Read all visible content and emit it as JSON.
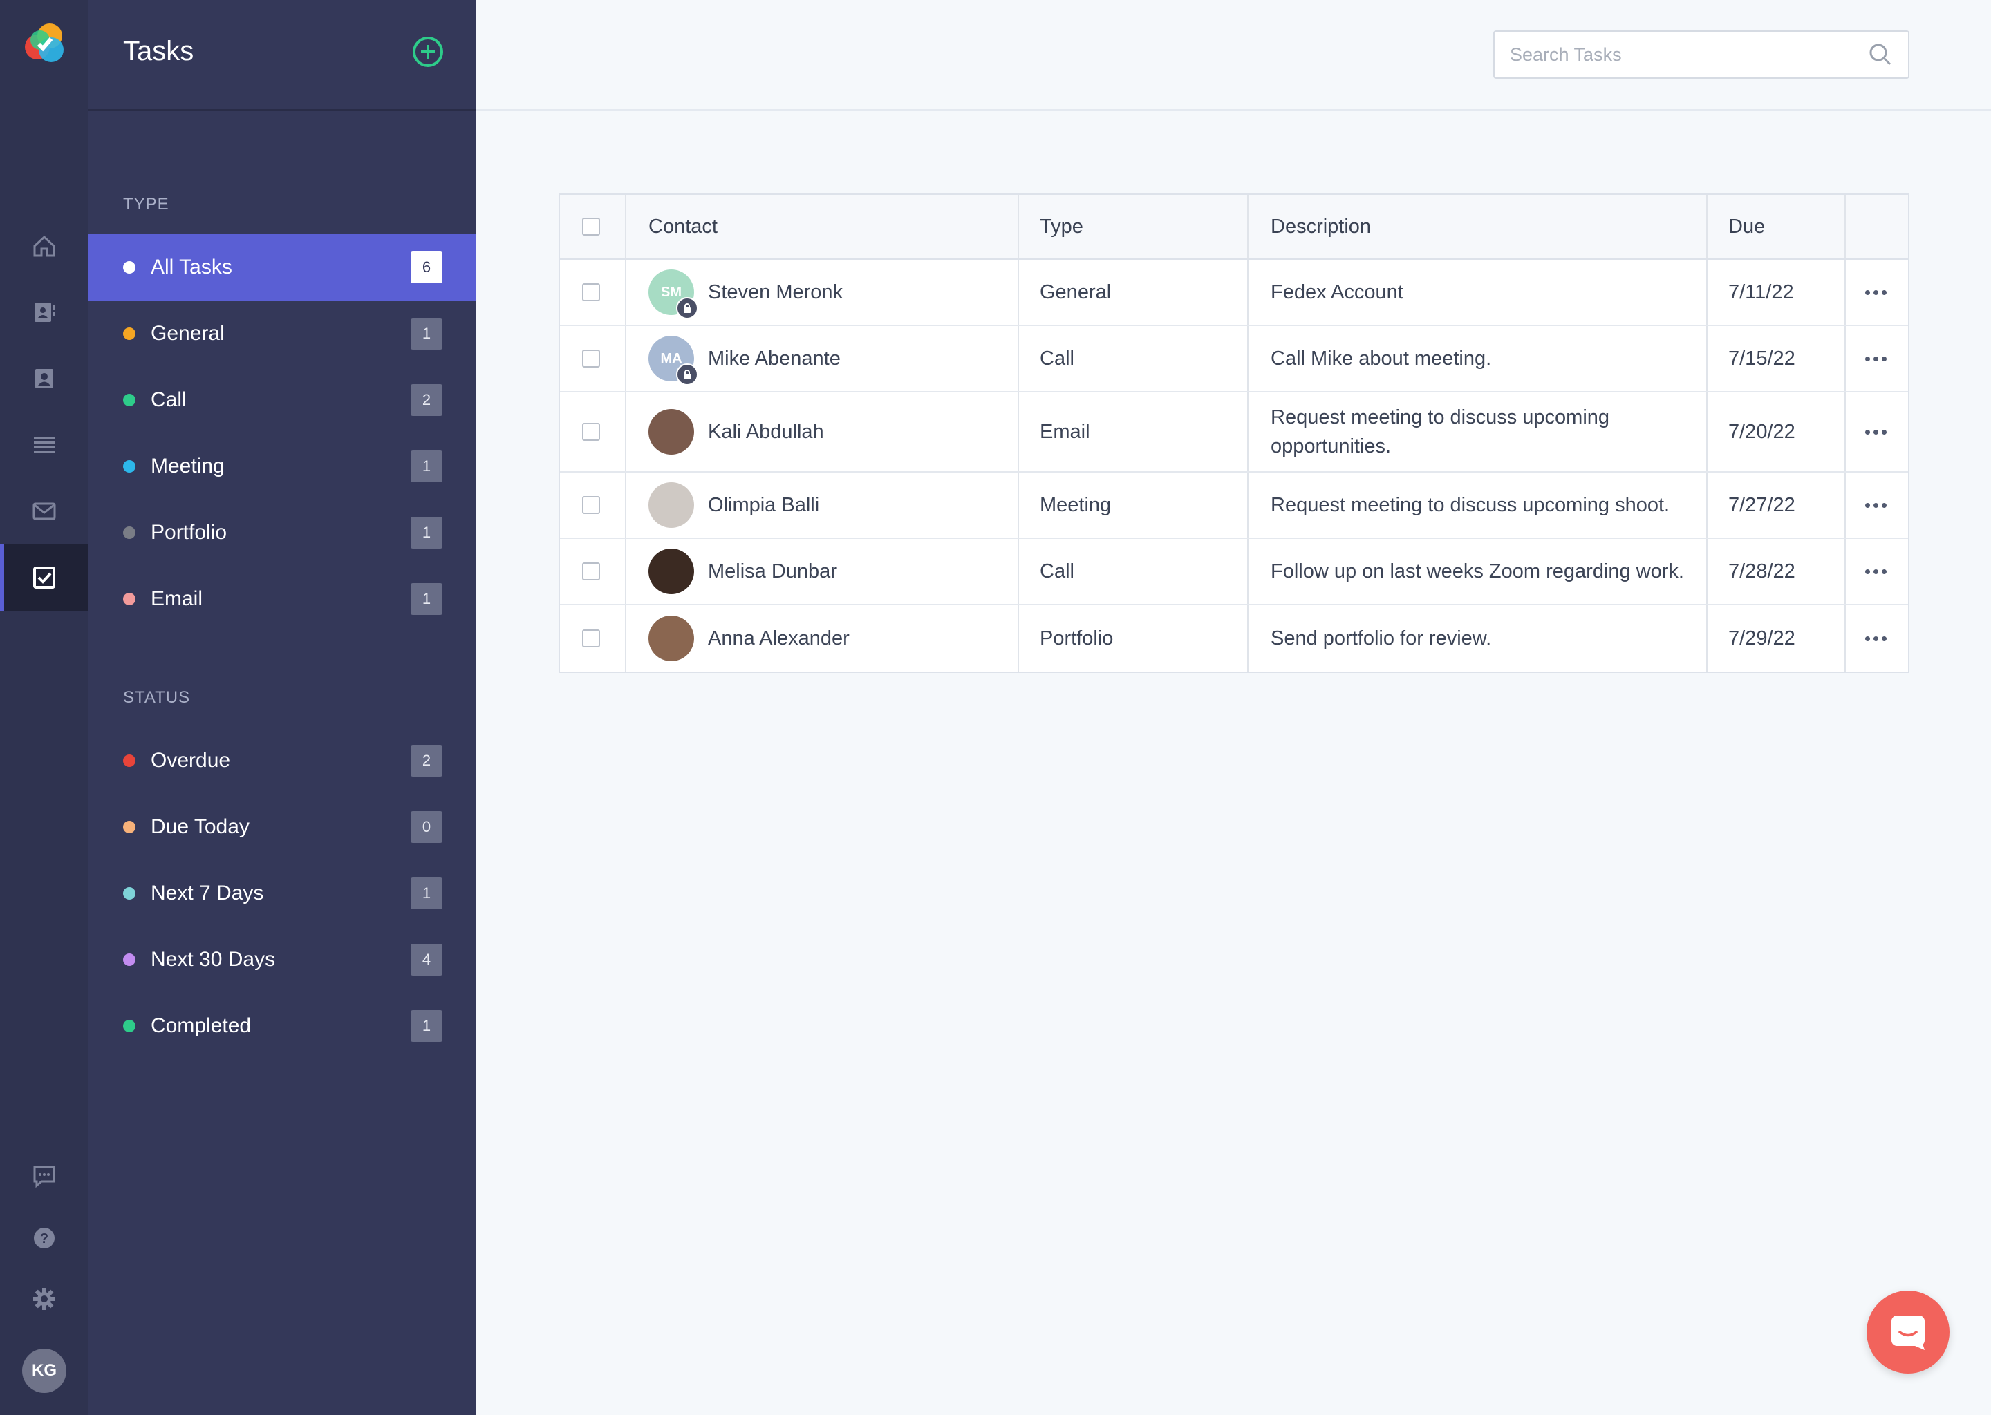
{
  "rail": {
    "icons": [
      "home-icon",
      "contacts-icon",
      "contact-card-icon",
      "list-icon",
      "mail-icon",
      "tasks-icon"
    ],
    "bottom_icons": [
      "feedback-icon",
      "help-icon",
      "settings-icon"
    ],
    "user_initials": "KG"
  },
  "panel": {
    "title": "Tasks",
    "type_label": "TYPE",
    "status_label": "STATUS",
    "types": [
      {
        "label": "All Tasks",
        "count": "6",
        "color": "#ffffff",
        "active": true
      },
      {
        "label": "General",
        "count": "1",
        "color": "#f5a623"
      },
      {
        "label": "Call",
        "count": "2",
        "color": "#2ecc8a"
      },
      {
        "label": "Meeting",
        "count": "1",
        "color": "#2db7ea"
      },
      {
        "label": "Portfolio",
        "count": "1",
        "color": "#7a7d86"
      },
      {
        "label": "Email",
        "count": "1",
        "color": "#f29b9b"
      }
    ],
    "statuses": [
      {
        "label": "Overdue",
        "count": "2",
        "color": "#e8443a"
      },
      {
        "label": "Due Today",
        "count": "0",
        "color": "#f7b27a"
      },
      {
        "label": "Next 7 Days",
        "count": "1",
        "color": "#7fd3d8"
      },
      {
        "label": "Next 30 Days",
        "count": "4",
        "color": "#c28cf0"
      },
      {
        "label": "Completed",
        "count": "1",
        "color": "#2ecc8a"
      }
    ]
  },
  "search": {
    "placeholder": "Search Tasks"
  },
  "table": {
    "headers": {
      "contact": "Contact",
      "type": "Type",
      "description": "Description",
      "due": "Due"
    },
    "rows": [
      {
        "contact": "Steven Meronk",
        "initials": "SM",
        "avatar_color": "#a7dcc4",
        "locked": true,
        "type": "General",
        "description": "Fedex Account",
        "due": "7/11/22"
      },
      {
        "contact": "Mike Abenante",
        "initials": "MA",
        "avatar_color": "#a7b9d3",
        "locked": true,
        "type": "Call",
        "description": "Call Mike about meeting.",
        "due": "7/15/22"
      },
      {
        "contact": "Kali Abdullah",
        "initials": "",
        "avatar_color": "#7a5a4c",
        "locked": false,
        "type": "Email",
        "description": "Request meeting to discuss upcoming opportunities.",
        "due": "7/20/22"
      },
      {
        "contact": "Olimpia Balli",
        "initials": "",
        "avatar_color": "#cfc9c4",
        "locked": false,
        "type": "Meeting",
        "description": "Request meeting to discuss upcoming shoot.",
        "due": "7/27/22"
      },
      {
        "contact": "Melisa Dunbar",
        "initials": "",
        "avatar_color": "#3b2a22",
        "locked": false,
        "type": "Call",
        "description": "Follow up on last weeks Zoom regarding work.",
        "due": "7/28/22"
      },
      {
        "contact": "Anna Alexander",
        "initials": "",
        "avatar_color": "#8a6650",
        "locked": false,
        "type": "Portfolio",
        "description": "Send portfolio for review.",
        "due": "7/29/22"
      }
    ]
  }
}
